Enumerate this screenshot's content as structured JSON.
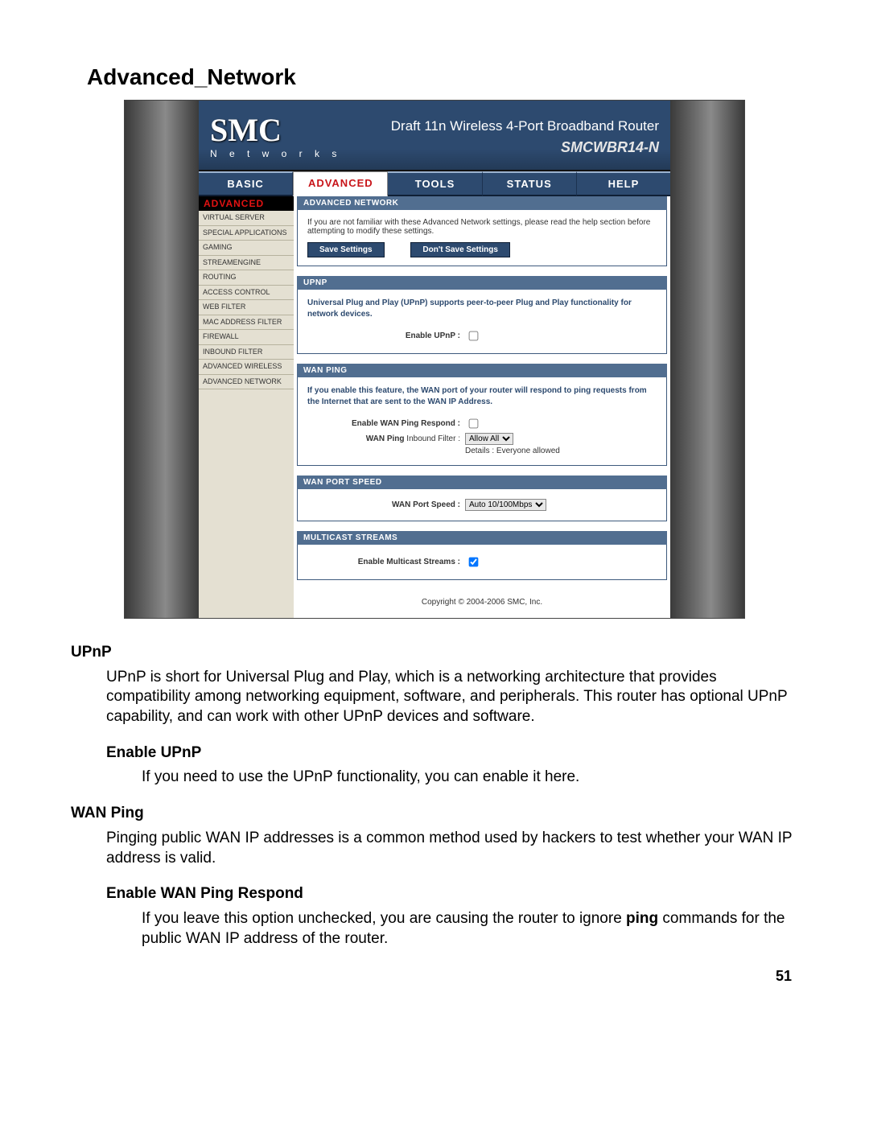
{
  "doc": {
    "title": "Advanced_Network",
    "page_number": "51",
    "sections": {
      "upnp_h": "UPnP",
      "upnp_p": "UPnP is short for Universal Plug and Play, which is a networking architecture that provides compatibility among networking equipment, software, and peripherals. This router has optional UPnP capability, and can work with other UPnP devices and software.",
      "enable_upnp_h": "Enable UPnP",
      "enable_upnp_p": "If you need to use the UPnP functionality, you can enable it here.",
      "wan_ping_h": "WAN Ping",
      "wan_ping_p": "Pinging public WAN IP addresses is a common method used by hackers to test whether your WAN IP address is valid.",
      "enable_wan_ping_h": "Enable WAN Ping Respond",
      "enable_wan_ping_p1": "If you leave this option unchecked, you are causing the router to ignore ",
      "enable_wan_ping_strong": "ping",
      "enable_wan_ping_p2": " commands for the public WAN IP address of the router."
    }
  },
  "router": {
    "brand": "SMC",
    "brand_sub": "N e t w o r k s",
    "banner_title": "Draft 11n Wireless 4-Port Broadband Router",
    "model": "SMCWBR14-N",
    "topnav": [
      "Basic",
      "Advanced",
      "Tools",
      "Status",
      "Help"
    ],
    "sidebar_head": "ADVANCED",
    "sidebar": [
      "Virtual Server",
      "Special Applications",
      "Gaming",
      "StreamEngine",
      "Routing",
      "Access Control",
      "Web Filter",
      "MAC Address Filter",
      "Firewall",
      "Inbound Filter",
      "Advanced Wireless",
      "Advanced Network"
    ],
    "adv_net": {
      "bar": "Advanced Network",
      "note": "If you are not familiar with these Advanced Network settings, please read the help section before attempting to modify these settings.",
      "save_btn": "Save Settings",
      "dontsave_btn": "Don't Save Settings"
    },
    "upnp": {
      "bar": "UPNP",
      "desc": "Universal Plug and Play (UPnP) supports peer-to-peer Plug and Play functionality for network devices.",
      "label": "Enable UPnP :"
    },
    "wanping": {
      "bar": "WAN Ping",
      "desc": "If you enable this feature, the WAN port of your router will respond to ping requests from the Internet that are sent to the WAN IP Address.",
      "label1": "Enable WAN Ping Respond :",
      "label2a": "WAN Ping",
      "label2b": " Inbound Filter :",
      "select": "Allow All",
      "details": "Details : Everyone allowed"
    },
    "portspeed": {
      "bar": "WAN Port Speed",
      "label": "WAN Port Speed :",
      "select": "Auto 10/100Mbps"
    },
    "multicast": {
      "bar": "Multicast Streams",
      "label": "Enable Multicast Streams :"
    },
    "copyright": "Copyright © 2004-2006 SMC, Inc."
  }
}
